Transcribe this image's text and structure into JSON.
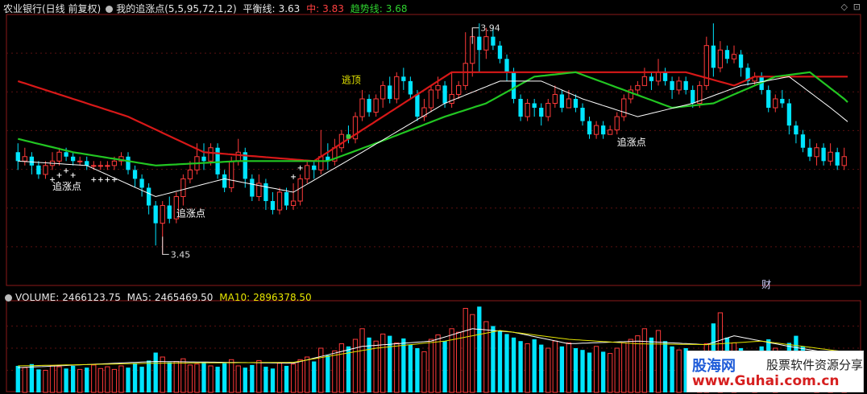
{
  "header": {
    "stock": "农业银行(日线 前复权)",
    "indicator": "我的追涨点(5,5,95,72,1,2)",
    "balance_label": "平衡线:",
    "balance_value": "3.63",
    "mid_label": "中:",
    "mid_value": "3.83",
    "trend_label": "趋势线:",
    "trend_value": "3.68"
  },
  "volume_header": {
    "volume_label": "VOLUME:",
    "volume_value": "2466123.75",
    "ma5_label": "MA5:",
    "ma5_value": "2465469.50",
    "ma10_label": "MA10:",
    "ma10_value": "2896378.50"
  },
  "annotations": {
    "high_price": "3.94",
    "low_price": "3.45",
    "escape_top": "逃顶",
    "chase_1": "追涨点",
    "chase_2": "追涨点",
    "chase_3": "追涨点",
    "finance_mark": "财"
  },
  "watermark": {
    "site_cn": "股海网",
    "slogan": "股票软件资源分享",
    "url": "www.Guhai.com.cn"
  },
  "colors": {
    "up": "#ff3a3a",
    "down": "#00e5ff",
    "balance": "#d81818",
    "trend": "#22c622",
    "mid": "#ffffff",
    "ma10": "#e6e600"
  },
  "chart_data": {
    "type": "candlestick",
    "price_range": [
      3.38,
      3.99
    ],
    "candles": [
      [
        3.68,
        3.66,
        3.7,
        3.64
      ],
      [
        3.66,
        3.67,
        3.69,
        3.65
      ],
      [
        3.67,
        3.65,
        3.68,
        3.63
      ],
      [
        3.65,
        3.63,
        3.66,
        3.62
      ],
      [
        3.63,
        3.65,
        3.66,
        3.62
      ],
      [
        3.65,
        3.66,
        3.68,
        3.64
      ],
      [
        3.66,
        3.68,
        3.69,
        3.65
      ],
      [
        3.68,
        3.67,
        3.69,
        3.66
      ],
      [
        3.67,
        3.66,
        3.68,
        3.65
      ],
      [
        3.66,
        3.66,
        3.67,
        3.65
      ],
      [
        3.66,
        3.65,
        3.67,
        3.64
      ],
      [
        3.65,
        3.65,
        3.66,
        3.64
      ],
      [
        3.65,
        3.65,
        3.66,
        3.64
      ],
      [
        3.65,
        3.65,
        3.66,
        3.64
      ],
      [
        3.65,
        3.66,
        3.67,
        3.64
      ],
      [
        3.66,
        3.67,
        3.68,
        3.65
      ],
      [
        3.67,
        3.64,
        3.68,
        3.63
      ],
      [
        3.64,
        3.62,
        3.65,
        3.6
      ],
      [
        3.62,
        3.6,
        3.63,
        3.58
      ],
      [
        3.6,
        3.56,
        3.61,
        3.54
      ],
      [
        3.56,
        3.52,
        3.57,
        3.47
      ],
      [
        3.52,
        3.56,
        3.57,
        3.45
      ],
      [
        3.56,
        3.53,
        3.58,
        3.52
      ],
      [
        3.53,
        3.58,
        3.59,
        3.52
      ],
      [
        3.58,
        3.62,
        3.63,
        3.56
      ],
      [
        3.62,
        3.64,
        3.66,
        3.61
      ],
      [
        3.64,
        3.67,
        3.7,
        3.63
      ],
      [
        3.67,
        3.66,
        3.7,
        3.64
      ],
      [
        3.66,
        3.69,
        3.7,
        3.65
      ],
      [
        3.69,
        3.63,
        3.7,
        3.62
      ],
      [
        3.63,
        3.6,
        3.64,
        3.59
      ],
      [
        3.6,
        3.66,
        3.67,
        3.59
      ],
      [
        3.66,
        3.68,
        3.71,
        3.65
      ],
      [
        3.68,
        3.62,
        3.69,
        3.6
      ],
      [
        3.62,
        3.58,
        3.63,
        3.57
      ],
      [
        3.58,
        3.61,
        3.63,
        3.57
      ],
      [
        3.61,
        3.57,
        3.62,
        3.55
      ],
      [
        3.57,
        3.55,
        3.59,
        3.54
      ],
      [
        3.55,
        3.59,
        3.6,
        3.54
      ],
      [
        3.59,
        3.56,
        3.6,
        3.55
      ],
      [
        3.56,
        3.57,
        3.61,
        3.55
      ],
      [
        3.57,
        3.62,
        3.63,
        3.56
      ],
      [
        3.62,
        3.65,
        3.66,
        3.61
      ],
      [
        3.65,
        3.64,
        3.66,
        3.62
      ],
      [
        3.64,
        3.67,
        3.73,
        3.63
      ],
      [
        3.67,
        3.66,
        3.7,
        3.64
      ],
      [
        3.66,
        3.69,
        3.71,
        3.65
      ],
      [
        3.69,
        3.72,
        3.73,
        3.68
      ],
      [
        3.72,
        3.71,
        3.74,
        3.7
      ],
      [
        3.71,
        3.76,
        3.77,
        3.7
      ],
      [
        3.76,
        3.8,
        3.82,
        3.75
      ],
      [
        3.8,
        3.77,
        3.81,
        3.76
      ],
      [
        3.77,
        3.8,
        3.81,
        3.76
      ],
      [
        3.8,
        3.83,
        3.84,
        3.78
      ],
      [
        3.83,
        3.8,
        3.85,
        3.79
      ],
      [
        3.8,
        3.85,
        3.86,
        3.79
      ],
      [
        3.85,
        3.84,
        3.87,
        3.82
      ],
      [
        3.84,
        3.81,
        3.85,
        3.8
      ],
      [
        3.81,
        3.76,
        3.82,
        3.75
      ],
      [
        3.76,
        3.78,
        3.8,
        3.75
      ],
      [
        3.78,
        3.82,
        3.83,
        3.77
      ],
      [
        3.82,
        3.83,
        3.85,
        3.8
      ],
      [
        3.83,
        3.79,
        3.84,
        3.78
      ],
      [
        3.79,
        3.81,
        3.86,
        3.78
      ],
      [
        3.81,
        3.83,
        3.84,
        3.8
      ],
      [
        3.83,
        3.88,
        3.95,
        3.82
      ],
      [
        3.88,
        3.94,
        3.96,
        3.85
      ],
      [
        3.94,
        3.91,
        3.97,
        3.86
      ],
      [
        3.91,
        3.94,
        3.96,
        3.89
      ],
      [
        3.94,
        3.92,
        3.96,
        3.91
      ],
      [
        3.92,
        3.89,
        3.93,
        3.88
      ],
      [
        3.89,
        3.86,
        3.9,
        3.84
      ],
      [
        3.86,
        3.8,
        3.87,
        3.79
      ],
      [
        3.8,
        3.76,
        3.81,
        3.75
      ],
      [
        3.76,
        3.79,
        3.8,
        3.75
      ],
      [
        3.79,
        3.78,
        3.8,
        3.76
      ],
      [
        3.78,
        3.76,
        3.79,
        3.74
      ],
      [
        3.76,
        3.79,
        3.8,
        3.75
      ],
      [
        3.79,
        3.81,
        3.83,
        3.78
      ],
      [
        3.81,
        3.78,
        3.82,
        3.77
      ],
      [
        3.78,
        3.8,
        3.82,
        3.78
      ],
      [
        3.8,
        3.78,
        3.81,
        3.77
      ],
      [
        3.78,
        3.75,
        3.79,
        3.74
      ],
      [
        3.75,
        3.72,
        3.76,
        3.71
      ],
      [
        3.72,
        3.74,
        3.75,
        3.71
      ],
      [
        3.74,
        3.72,
        3.75,
        3.71
      ],
      [
        3.72,
        3.73,
        3.74,
        3.72
      ],
      [
        3.73,
        3.76,
        3.77,
        3.72
      ],
      [
        3.76,
        3.8,
        3.81,
        3.75
      ],
      [
        3.8,
        3.82,
        3.83,
        3.79
      ],
      [
        3.82,
        3.83,
        3.84,
        3.81
      ],
      [
        3.83,
        3.85,
        3.87,
        3.83
      ],
      [
        3.85,
        3.84,
        3.86,
        3.82
      ],
      [
        3.84,
        3.86,
        3.89,
        3.83
      ],
      [
        3.86,
        3.84,
        3.87,
        3.83
      ],
      [
        3.84,
        3.82,
        3.85,
        3.8
      ],
      [
        3.82,
        3.84,
        3.85,
        3.81
      ],
      [
        3.84,
        3.82,
        3.85,
        3.81
      ],
      [
        3.82,
        3.79,
        3.83,
        3.78
      ],
      [
        3.79,
        3.83,
        3.84,
        3.78
      ],
      [
        3.83,
        3.92,
        3.94,
        3.82
      ],
      [
        3.92,
        3.87,
        3.97,
        3.85
      ],
      [
        3.87,
        3.91,
        3.93,
        3.86
      ],
      [
        3.91,
        3.89,
        3.92,
        3.88
      ],
      [
        3.89,
        3.9,
        3.92,
        3.88
      ],
      [
        3.9,
        3.87,
        3.91,
        3.85
      ],
      [
        3.87,
        3.84,
        3.88,
        3.83
      ],
      [
        3.84,
        3.85,
        3.86,
        3.83
      ],
      [
        3.85,
        3.82,
        3.86,
        3.81
      ],
      [
        3.82,
        3.78,
        3.83,
        3.77
      ],
      [
        3.78,
        3.8,
        3.81,
        3.77
      ],
      [
        3.8,
        3.79,
        3.82,
        3.78
      ],
      [
        3.79,
        3.74,
        3.8,
        3.72
      ],
      [
        3.74,
        3.72,
        3.75,
        3.7
      ],
      [
        3.72,
        3.69,
        3.73,
        3.68
      ],
      [
        3.69,
        3.67,
        3.71,
        3.66
      ],
      [
        3.67,
        3.69,
        3.7,
        3.65
      ],
      [
        3.69,
        3.66,
        3.7,
        3.65
      ],
      [
        3.66,
        3.68,
        3.7,
        3.65
      ],
      [
        3.68,
        3.65,
        3.69,
        3.64
      ],
      [
        3.65,
        3.67,
        3.69,
        3.64
      ]
    ],
    "balance_line": [
      [
        0,
        3.84
      ],
      [
        16,
        3.76
      ],
      [
        27,
        3.68
      ],
      [
        43,
        3.66
      ],
      [
        63,
        3.86
      ],
      [
        97,
        3.86
      ],
      [
        104,
        3.83
      ],
      [
        107,
        3.85
      ],
      [
        126,
        3.85
      ]
    ],
    "trend_line": [
      [
        0,
        3.71
      ],
      [
        8,
        3.68
      ],
      [
        20,
        3.65
      ],
      [
        32,
        3.66
      ],
      [
        45,
        3.66
      ],
      [
        52,
        3.7
      ],
      [
        62,
        3.76
      ],
      [
        68,
        3.79
      ],
      [
        75,
        3.85
      ],
      [
        81,
        3.86
      ],
      [
        88,
        3.82
      ],
      [
        95,
        3.78
      ],
      [
        101,
        3.79
      ],
      [
        110,
        3.85
      ],
      [
        115,
        3.86
      ],
      [
        120,
        3.8
      ],
      [
        126,
        3.71
      ]
    ],
    "mid_line": [
      [
        0,
        3.66
      ],
      [
        10,
        3.65
      ],
      [
        20,
        3.58
      ],
      [
        30,
        3.62
      ],
      [
        40,
        3.59
      ],
      [
        50,
        3.68
      ],
      [
        62,
        3.79
      ],
      [
        70,
        3.84
      ],
      [
        76,
        3.84
      ],
      [
        82,
        3.8
      ],
      [
        90,
        3.76
      ],
      [
        98,
        3.79
      ],
      [
        105,
        3.83
      ],
      [
        112,
        3.85
      ],
      [
        118,
        3.78
      ],
      [
        126,
        3.68
      ]
    ],
    "volume": [
      0.3,
      0.28,
      0.32,
      0.26,
      0.25,
      0.3,
      0.29,
      0.27,
      0.3,
      0.26,
      0.28,
      0.31,
      0.27,
      0.29,
      0.26,
      0.3,
      0.28,
      0.33,
      0.29,
      0.36,
      0.45,
      0.4,
      0.34,
      0.35,
      0.38,
      0.31,
      0.32,
      0.34,
      0.3,
      0.29,
      0.33,
      0.37,
      0.3,
      0.28,
      0.31,
      0.36,
      0.29,
      0.27,
      0.33,
      0.3,
      0.32,
      0.37,
      0.4,
      0.35,
      0.5,
      0.42,
      0.47,
      0.55,
      0.52,
      0.6,
      0.72,
      0.62,
      0.58,
      0.66,
      0.64,
      0.56,
      0.61,
      0.54,
      0.5,
      0.46,
      0.6,
      0.65,
      0.58,
      0.72,
      0.68,
      0.95,
      0.88,
      0.97,
      0.8,
      0.75,
      0.7,
      0.66,
      0.62,
      0.58,
      0.55,
      0.6,
      0.54,
      0.5,
      0.58,
      0.52,
      0.56,
      0.5,
      0.48,
      0.45,
      0.52,
      0.46,
      0.44,
      0.5,
      0.56,
      0.6,
      0.64,
      0.72,
      0.62,
      0.7,
      0.58,
      0.52,
      0.48,
      0.5,
      0.46,
      0.42,
      0.55,
      0.78,
      0.9,
      0.62,
      0.56,
      0.5,
      0.47,
      0.44,
      0.52,
      0.6,
      0.5,
      0.46,
      0.56,
      0.64,
      0.52,
      0.44,
      0.42,
      0.4,
      0.38,
      0.42,
      0.4
    ],
    "vol_ma5": [
      [
        0,
        0.28
      ],
      [
        20,
        0.35
      ],
      [
        40,
        0.33
      ],
      [
        50,
        0.52
      ],
      [
        60,
        0.58
      ],
      [
        66,
        0.72
      ],
      [
        72,
        0.68
      ],
      [
        80,
        0.55
      ],
      [
        90,
        0.58
      ],
      [
        100,
        0.54
      ],
      [
        104,
        0.64
      ],
      [
        112,
        0.52
      ],
      [
        120,
        0.42
      ]
    ],
    "vol_ma10": [
      [
        0,
        0.3
      ],
      [
        20,
        0.33
      ],
      [
        40,
        0.34
      ],
      [
        52,
        0.5
      ],
      [
        62,
        0.58
      ],
      [
        70,
        0.7
      ],
      [
        80,
        0.6
      ],
      [
        90,
        0.55
      ],
      [
        100,
        0.54
      ],
      [
        108,
        0.58
      ],
      [
        120,
        0.46
      ]
    ]
  }
}
